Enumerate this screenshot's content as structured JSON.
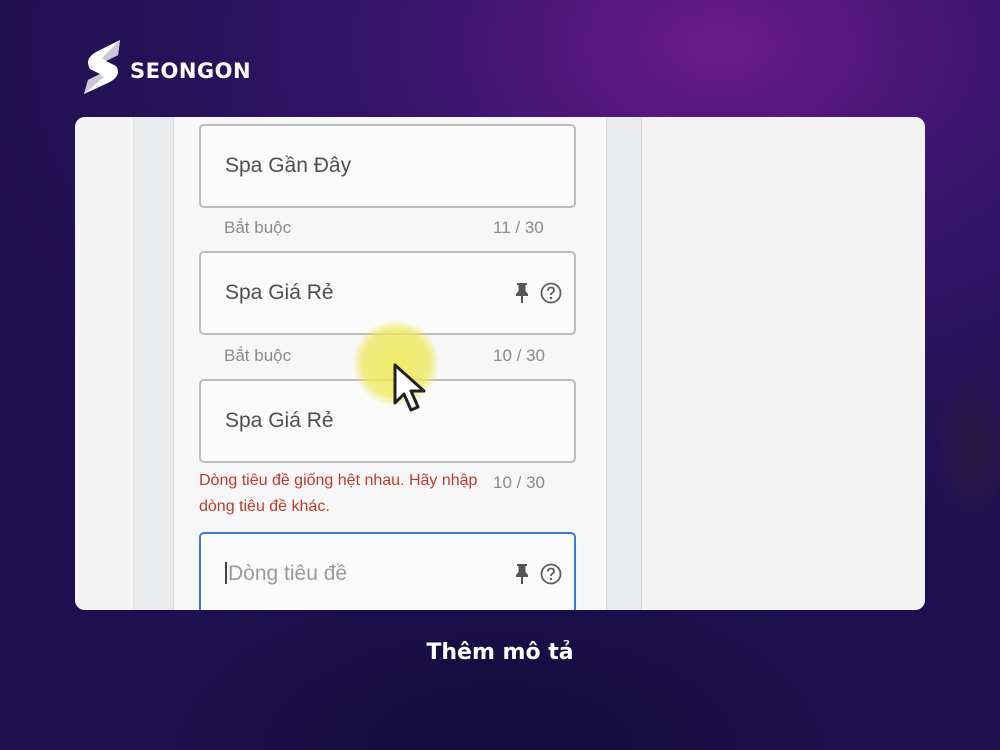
{
  "brand": {
    "name": "SEONGON",
    "logo_icon": "seongon-s-logo-icon"
  },
  "caption": "Thêm mô tả",
  "form": {
    "fields": [
      {
        "value": "Spa Gần Đây",
        "hint_left": "Bắt buộc",
        "counter": "11 / 30",
        "state": "filled"
      },
      {
        "value": "Spa Giá Rẻ",
        "hint_left": "Bắt buộc",
        "counter": "10 / 30",
        "state": "filled",
        "icons": [
          "pin-icon",
          "help-icon"
        ]
      },
      {
        "value": "Spa Giá Rẻ",
        "error": "Dòng tiêu đề giống hệt nhau. Hãy nhập dòng tiêu đề khác.",
        "counter": "10 / 30",
        "state": "error"
      },
      {
        "placeholder": "Dòng tiêu đề",
        "state": "focused",
        "icons": [
          "pin-icon",
          "help-icon"
        ]
      }
    ]
  },
  "colors": {
    "background": "#3d1570",
    "accent_focus": "#3b78d6",
    "error_text": "#c0392b",
    "cursor_highlight": "#efe850"
  }
}
